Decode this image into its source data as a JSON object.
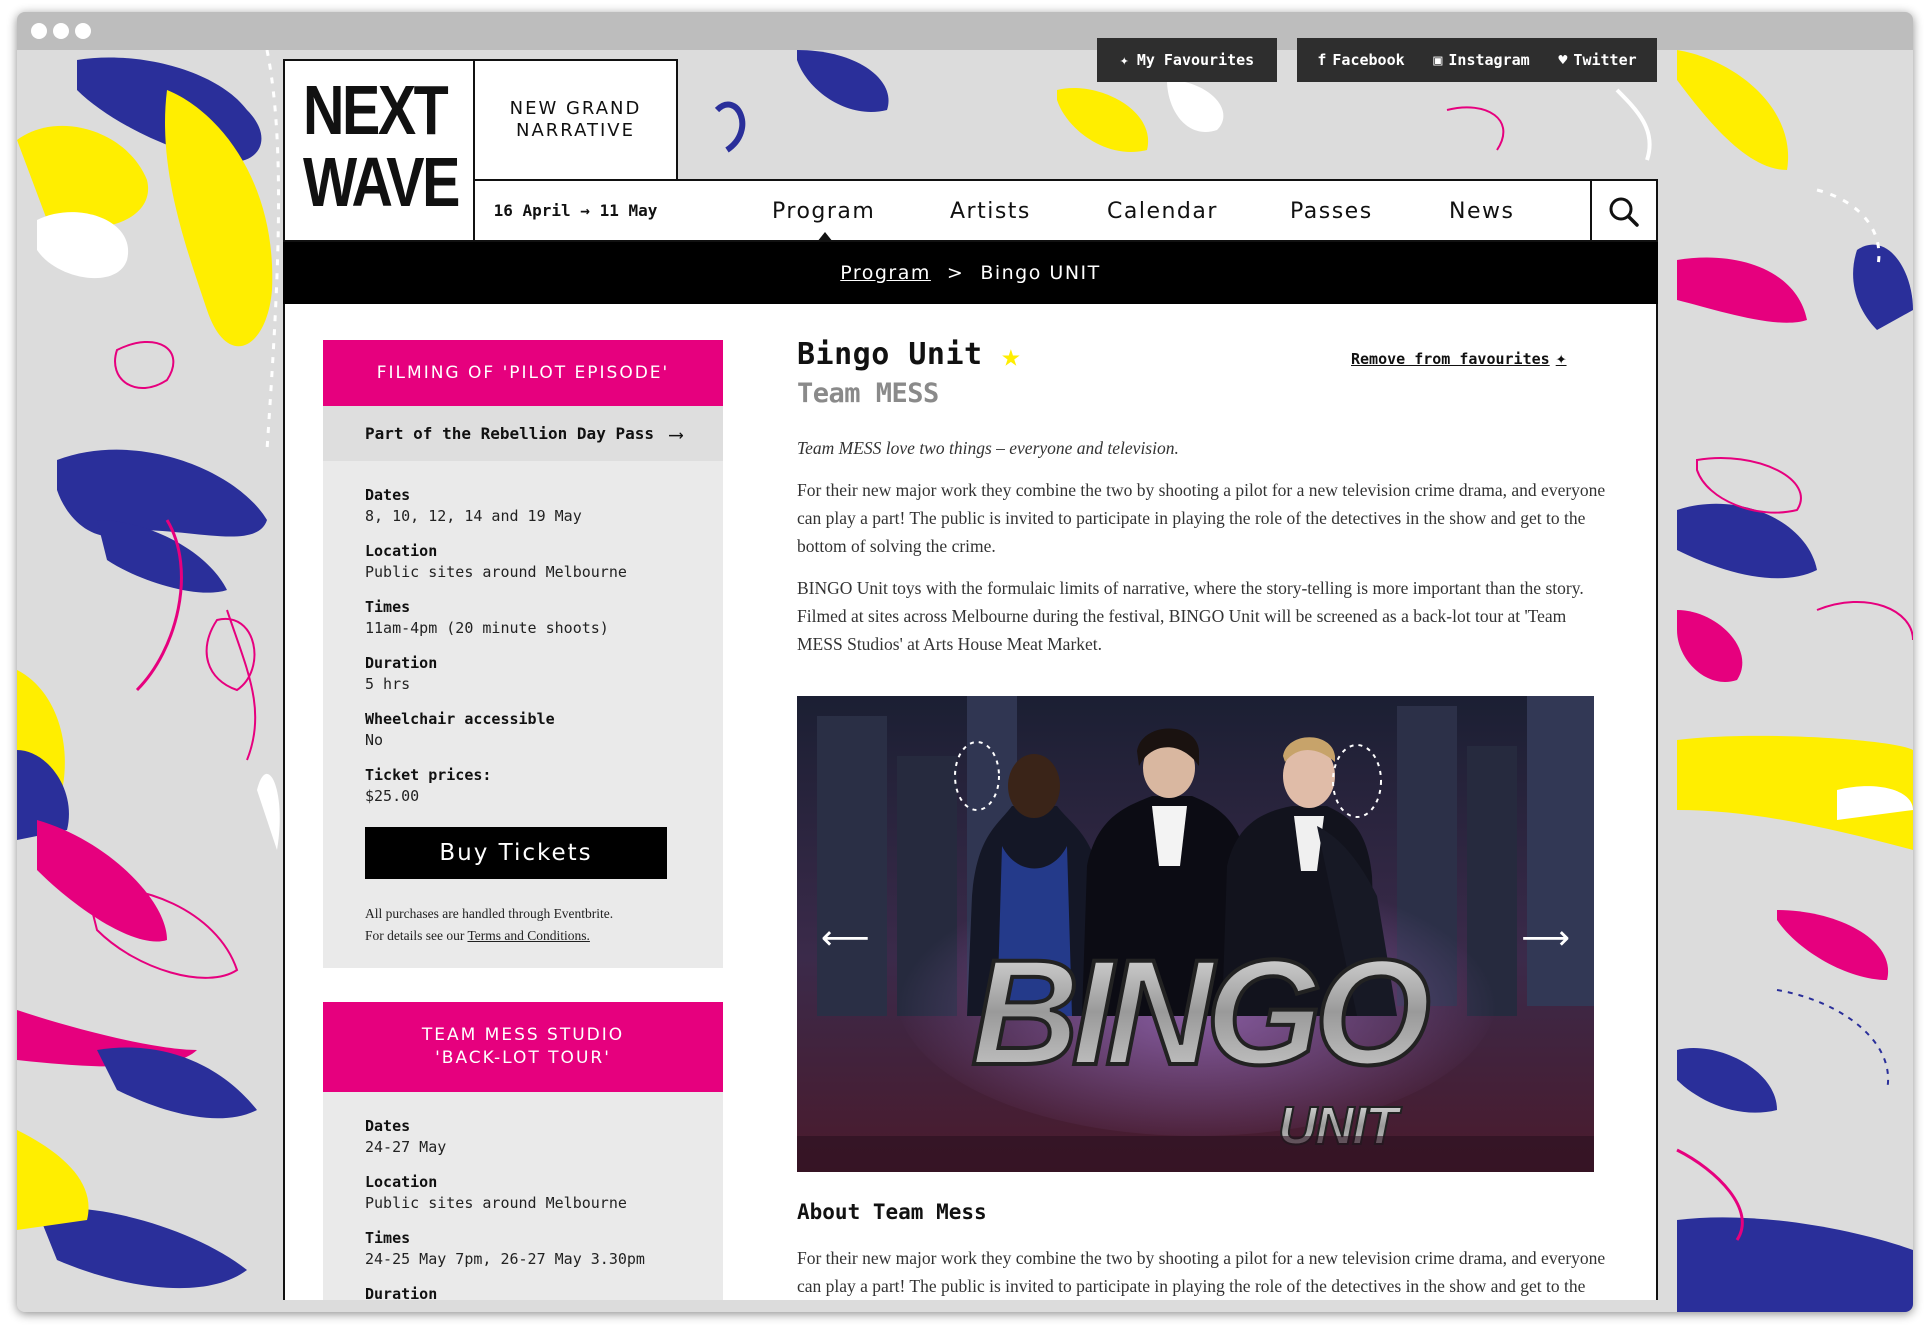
{
  "header": {
    "favourites_label": "My Favourites",
    "social": [
      {
        "icon": "facebook-icon",
        "label": "Facebook"
      },
      {
        "icon": "instagram-icon",
        "label": "Instagram"
      },
      {
        "icon": "twitter-icon",
        "label": "Twitter"
      }
    ],
    "logo_line1": "NEXT",
    "logo_line2": "WAVE",
    "tagline_line1": "NEW GRAND",
    "tagline_line2": "NARRATIVE",
    "dates": "16 April → 11 May"
  },
  "nav": {
    "items": [
      "Program",
      "Artists",
      "Calendar",
      "Passes",
      "News"
    ],
    "active": "Program",
    "search_icon": "search-icon"
  },
  "breadcrumb": {
    "parent": "Program",
    "separator": ">",
    "current": "Bingo UNIT"
  },
  "cards": [
    {
      "heading": "FILMING OF 'PILOT EPISODE'",
      "pass_label": "Part of the Rebellion Day Pass",
      "fields": [
        {
          "label": "Dates",
          "value": "8, 10, 12, 14 and 19 May"
        },
        {
          "label": "Location",
          "value": "Public sites around Melbourne"
        },
        {
          "label": "Times",
          "value": "11am-4pm (20 minute shoots)"
        },
        {
          "label": "Duration",
          "value": "5 hrs"
        },
        {
          "label": "Wheelchair accessible",
          "value": "No"
        },
        {
          "label": "Ticket prices:",
          "value": "$25.00"
        }
      ],
      "buy_label": "Buy Tickets",
      "note_line1": "All purchases are handled through Eventbrite.",
      "note_line2_prefix": "For details see our ",
      "note_link": "Terms and Conditions."
    },
    {
      "heading_line1": "TEAM MESS STUDIO",
      "heading_line2": "'BACK-LOT TOUR'",
      "fields": [
        {
          "label": "Dates",
          "value": "24-27 May"
        },
        {
          "label": "Location",
          "value": "Public sites around Melbourne"
        },
        {
          "label": "Times",
          "value": "24-25 May 7pm, 26-27 May 3.30pm"
        },
        {
          "label": "Duration",
          "value": ""
        }
      ]
    }
  ],
  "content": {
    "title": "Bingo Unit",
    "subtitle": "Team MESS",
    "remove_label": "Remove from favourites",
    "intro": "Team MESS love two things – everyone and television.",
    "p1": "For their new major work they combine the two by shooting a pilot for a new television crime drama, and everyone can play a part! The public is invited to participate in playing the role of the detectives in the show and get to the bottom of solving the crime.",
    "p2": "BINGO Unit toys with the formulaic limits of narrative, where the story-telling is more important than the story. Filmed at sites across Melbourne during the festival, BINGO Unit will be screened as a back-lot tour at 'Team MESS Studios' at Arts House Meat Market.",
    "image_word1": "BINGO",
    "image_word2": "UNIT",
    "about_heading": "About Team Mess",
    "p3": "For their new major work they combine the two by shooting a pilot for a new television crime drama, and everyone can play a part! The public is invited to participate in playing the role of the detectives in the show and get to the bottom of solving the crime."
  },
  "colors": {
    "accent_magenta": "#e6007e",
    "accent_yellow": "#ffee00",
    "accent_blue": "#2a2f9a",
    "nav_dark": "#2e2e2e"
  }
}
